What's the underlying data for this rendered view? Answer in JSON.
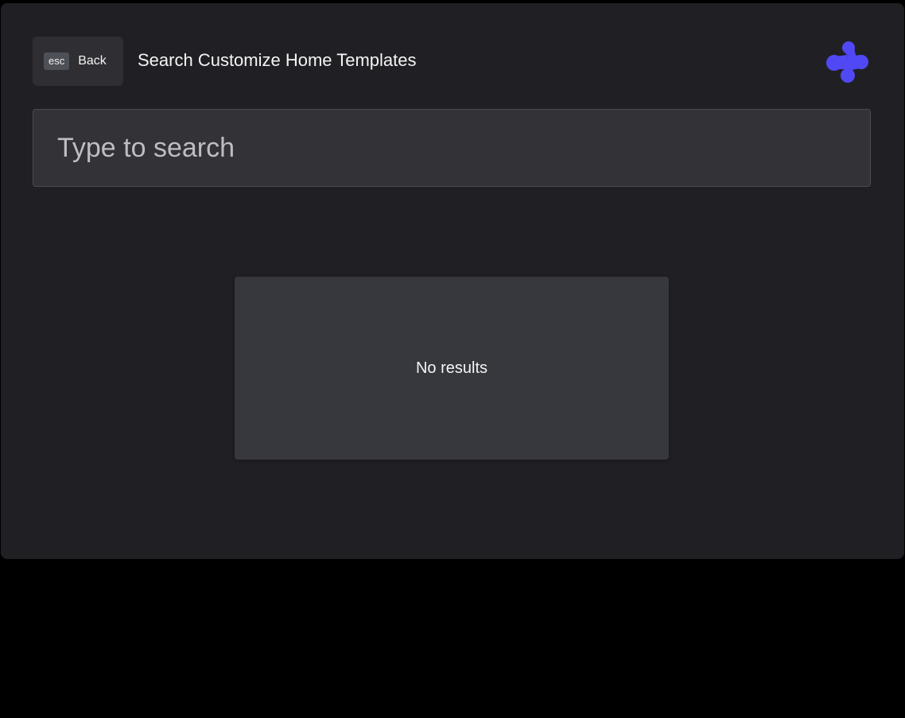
{
  "header": {
    "back_key": "esc",
    "back_label": "Back",
    "title": "Search Customize Home Templates",
    "logo_icon": "brand-logo-icon",
    "logo_color": "#5148f5"
  },
  "search": {
    "placeholder": "Type to search",
    "value": ""
  },
  "results": {
    "empty_message": "No results"
  },
  "colors": {
    "background": "#202024",
    "panel": "#37383d",
    "input": "#323237",
    "accent": "#5148f5"
  }
}
